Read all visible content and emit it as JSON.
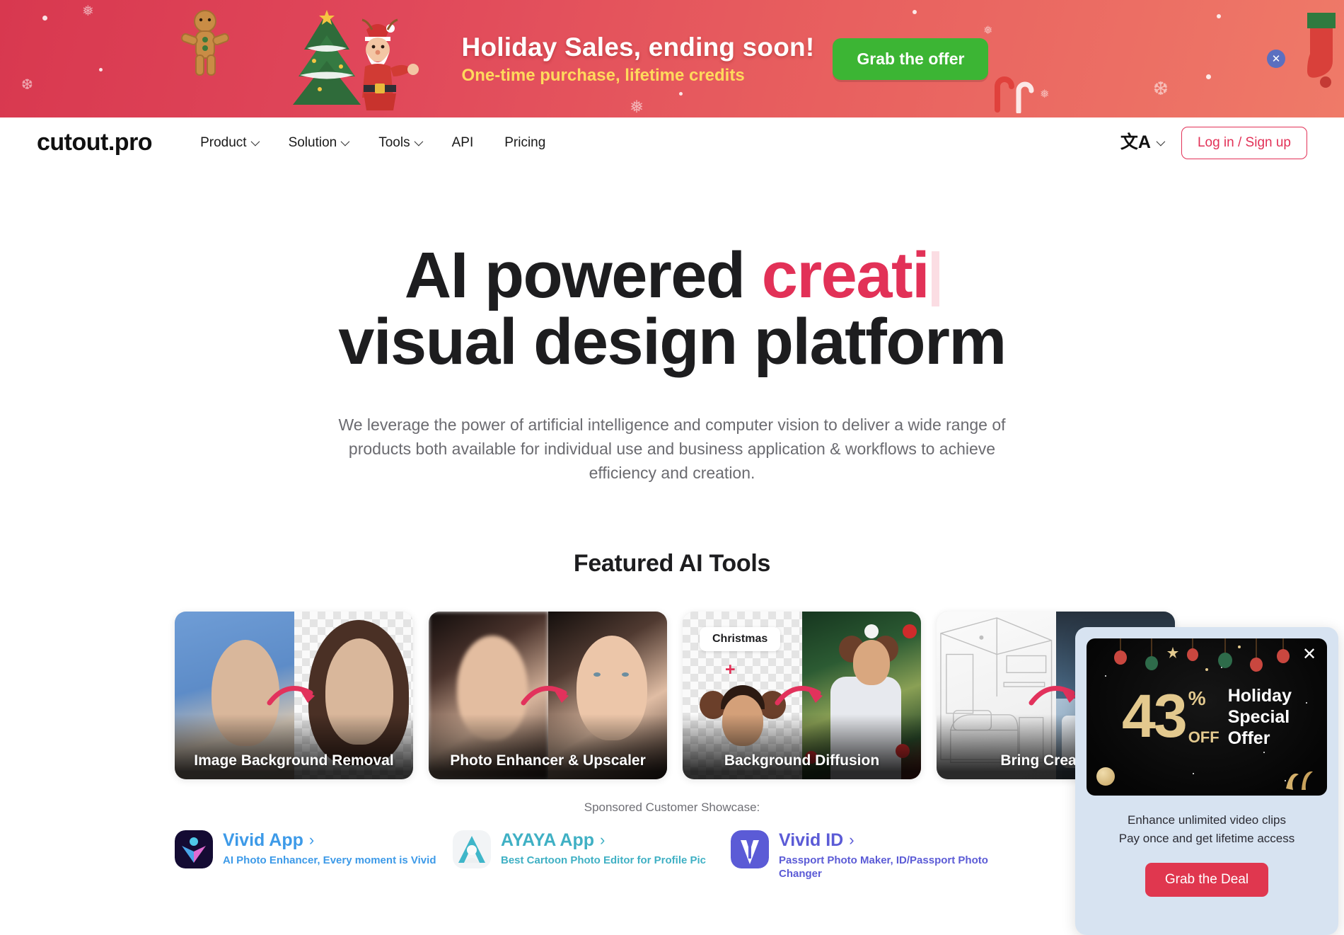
{
  "banner": {
    "title": "Holiday Sales, ending soon!",
    "subtitle": "One-time purchase, lifetime credits",
    "cta": "Grab the offer",
    "close_icon": "close-icon"
  },
  "nav": {
    "logo": "cutout.pro",
    "links": [
      {
        "label": "Product",
        "has_caret": true
      },
      {
        "label": "Solution",
        "has_caret": true
      },
      {
        "label": "Tools",
        "has_caret": true
      },
      {
        "label": "API",
        "has_caret": false
      },
      {
        "label": "Pricing",
        "has_caret": false
      }
    ],
    "language_icon": "文A",
    "login_label": "Log in / Sign up"
  },
  "hero": {
    "line1_plain": "AI powered ",
    "line1_accent": "creati",
    "line2": "visual design platform",
    "subtitle": "We leverage the power of artificial intelligence and computer vision to deliver a wide range of products both available for individual use and business application & workflows to achieve efficiency and creation."
  },
  "featured": {
    "title": "Featured AI Tools",
    "cards": [
      {
        "label": "Image Background Removal"
      },
      {
        "label": "Photo Enhancer & Upscaler"
      },
      {
        "label": "Background Diffusion",
        "chip": "Christmas",
        "plus": "+"
      },
      {
        "label": "Bring Creativity"
      }
    ]
  },
  "sponsor": {
    "caption": "Sponsored Customer Showcase:",
    "items": [
      {
        "name": "Vivid App",
        "chevron": "›",
        "desc": "AI Photo Enhancer, Every moment is Vivid"
      },
      {
        "name": "AYAYA App",
        "chevron": "›",
        "desc": "Best Cartoon Photo Editor for Profile Pic"
      },
      {
        "name": "Vivid ID",
        "chevron": "›",
        "desc": "Passport Photo Maker, ID/Passport Photo Changer"
      }
    ]
  },
  "popup": {
    "number": "43",
    "percent": "%",
    "off": "OFF",
    "headline_line1": "Holiday",
    "headline_line2": "Special",
    "headline_line3": "Offer",
    "text_line1": "Enhance unlimited video clips",
    "text_line2": "Pay once and get lifetime access",
    "cta": "Grab the Deal",
    "close_icon": "close-icon"
  },
  "colors": {
    "accent_red": "#e23157",
    "banner_green": "#3cb534",
    "popup_bg": "#d7e3f1",
    "gold": "#e3c98e",
    "sponsor_blue": "#3d9ae8"
  }
}
